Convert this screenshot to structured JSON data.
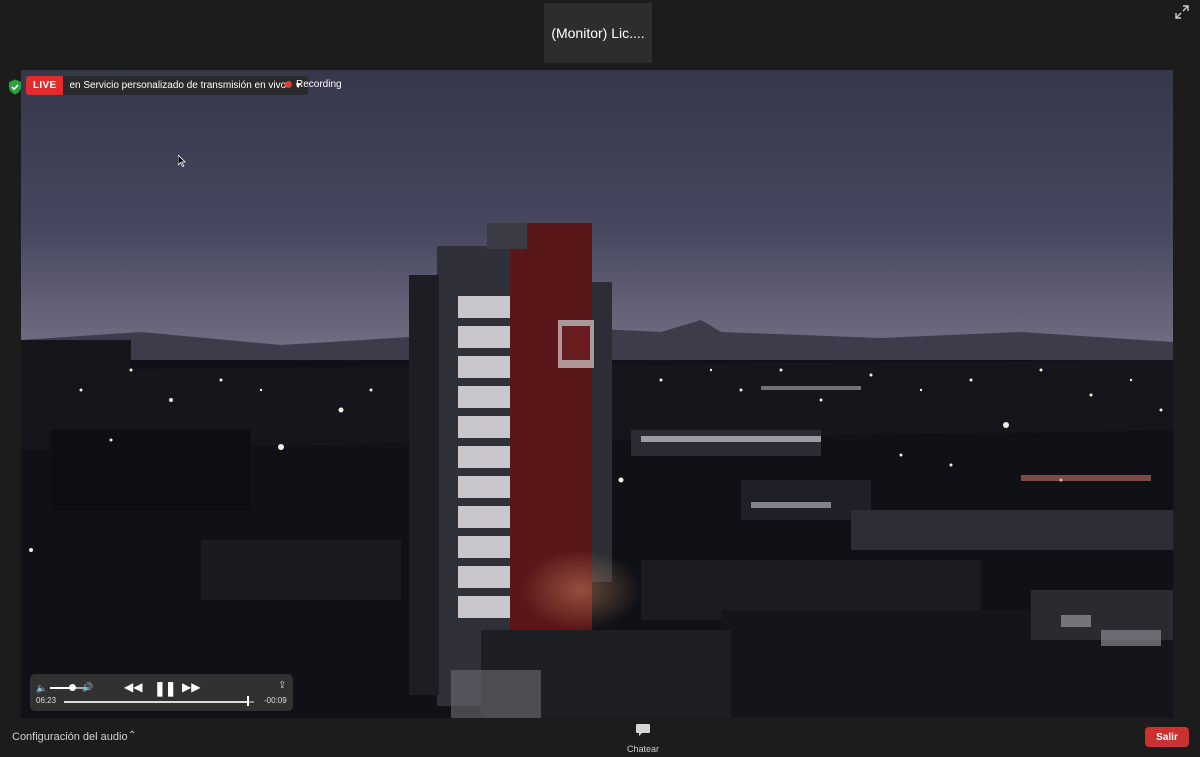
{
  "meeting": {
    "participant_name": "(Monitor) Lic....",
    "expand_icon": "expand-arrows-icon",
    "security_icon": "shield-check-icon"
  },
  "live_stream": {
    "badge": "LIVE",
    "service_text": "en Servicio personalizado de transmisión en vivo",
    "recording_label": "Recording"
  },
  "player": {
    "elapsed": "06:23",
    "remaining": "-00:09",
    "progress": 0.97,
    "volume": 0.55
  },
  "toolbar": {
    "audio_config_label": "Configuración del audio",
    "chat_label": "Chatear",
    "exit_label": "Salir"
  },
  "colors": {
    "live_red": "#e02c2c",
    "exit_red": "#c93231",
    "background": "#1c1c1c"
  }
}
